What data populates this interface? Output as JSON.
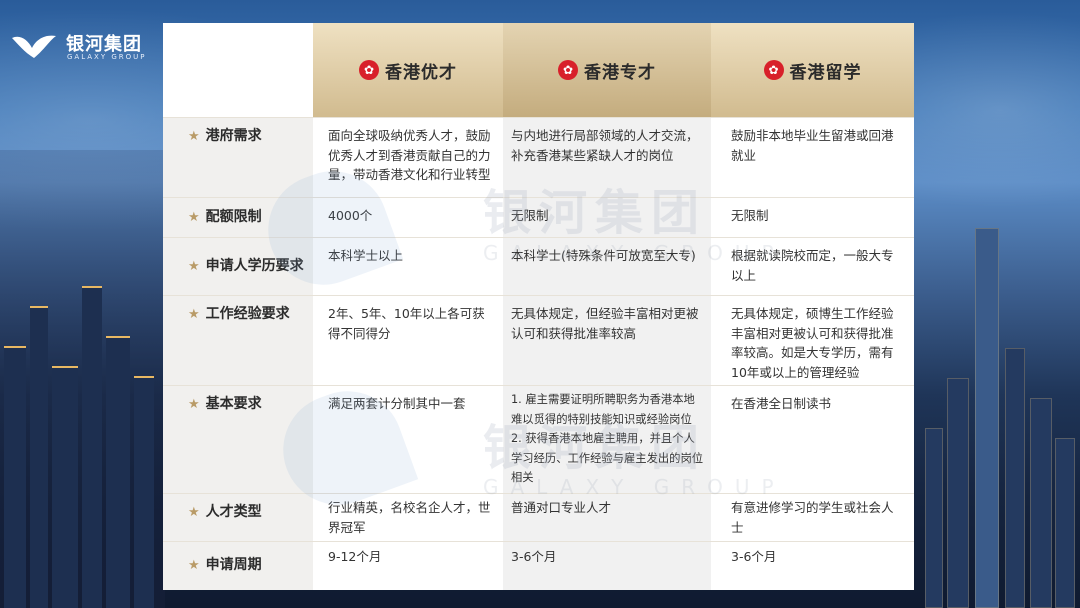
{
  "logo": {
    "cn": "银河集团",
    "en": "GALAXY GROUP"
  },
  "columns": [
    "",
    "香港优才",
    "香港专才",
    "香港留学"
  ],
  "icons": {
    "flag": "hk-bauhinia-flag-icon",
    "star": "star-icon",
    "logo": "whale-logo-icon"
  },
  "colors": {
    "header_gold": "#d1bb8f",
    "star_gold": "#b99b67",
    "label_bg": "#f1f0ee",
    "flag_red": "#d8202a"
  },
  "rows": [
    {
      "label": "港府需求",
      "c1": "面向全球吸纳优秀人才，鼓励优秀人才到香港贡献自己的力量，带动香港文化和行业转型",
      "c2": "与内地进行局部领域的人才交流，补充香港某些紧缺人才的岗位",
      "c3": "鼓励非本地毕业生留港或回港就业"
    },
    {
      "label": "配额限制",
      "c1": "4000个",
      "c2": "无限制",
      "c3": "无限制"
    },
    {
      "label": "申请人学历要求",
      "c1": "本科学士以上",
      "c2": "本科学士(特殊条件可放宽至大专)",
      "c3": "根据就读院校而定，一般大专以上"
    },
    {
      "label": "工作经验要求",
      "c1": "2年、5年、10年以上各可获得不同得分",
      "c2": "无具体规定，但经验丰富相对更被认可和获得批准率较高",
      "c3": "无具体规定，硕博生工作经验丰富相对更被认可和获得批准率较高。如是大专学历，需有10年或以上的管理经验"
    },
    {
      "label": "基本要求",
      "c1": "满足两套计分制其中一套",
      "c2": "1. 雇主需要证明所聘职务为香港本地难以觅得的特别技能知识或经验岗位\n2. 获得香港本地雇主聘用，并且个人学习经历、工作经验与雇主发出的岗位相关",
      "c3": "在香港全日制读书"
    },
    {
      "label": "人才类型",
      "c1": "行业精英，名校名企人才，世界冠军",
      "c2": "普通对口专业人才",
      "c3": "有意进修学习的学生或社会人士"
    },
    {
      "label": "申请周期",
      "c1": "9-12个月",
      "c2": "3-6个月",
      "c3": "3-6个月"
    }
  ],
  "watermark": {
    "cn": "银河集团",
    "en": "GALAXY GROUP"
  }
}
